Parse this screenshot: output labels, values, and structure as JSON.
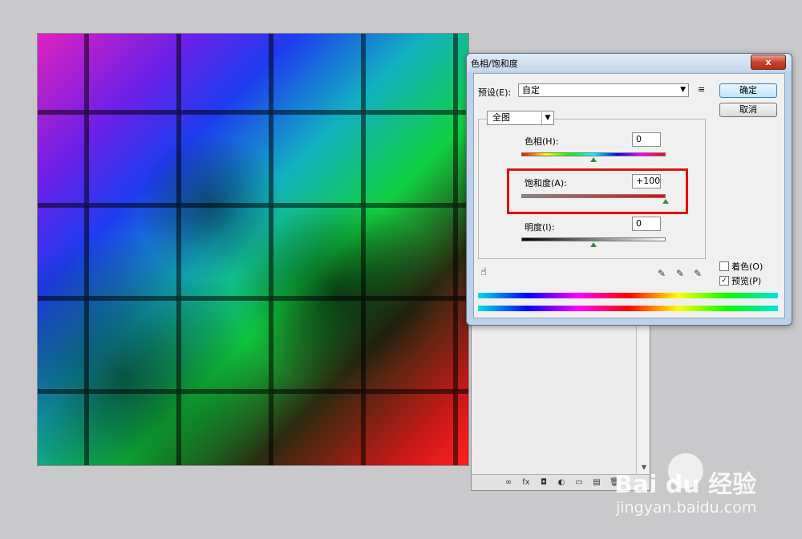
{
  "dialog": {
    "title": "色相/饱和度",
    "close_label": "x",
    "preset_label": "预设(E):",
    "preset_value": "自定",
    "preset_menu_icon": "≡",
    "ok_label": "确定",
    "cancel_label": "取消",
    "channel_value": "全图",
    "hue": {
      "label": "色相(H):",
      "value": "0",
      "level": 0.5
    },
    "saturation": {
      "label": "饱和度(A):",
      "value": "+100",
      "level": 1.0
    },
    "lightness": {
      "label": "明度(I):",
      "value": "0",
      "level": 0.5
    },
    "colorize_label": "着色(O)",
    "colorize_checked": false,
    "preview_label": "预览(P)",
    "preview_checked": true,
    "preview_check_mark": "✓"
  },
  "icons": {
    "hand": "targeted-adjustment-hand-icon",
    "eyedroppers": [
      "eyedropper-icon",
      "eyedropper-plus-icon",
      "eyedropper-minus-icon"
    ]
  },
  "layers_toolbar": [
    "∞",
    "fx",
    "◘",
    "◐",
    "▭",
    "▤",
    "🗑"
  ],
  "watermark": {
    "logo": "Bai  du 经验",
    "site": "jingyan.baidu.com"
  },
  "colors": {
    "highlight": "#e01010",
    "dialog_frame": "#bcd2ea"
  }
}
